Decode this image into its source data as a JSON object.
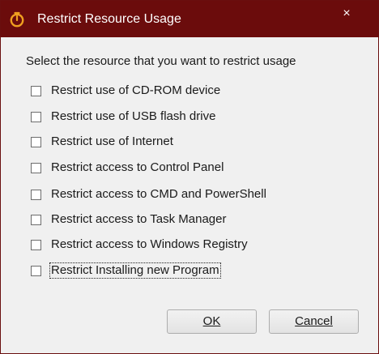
{
  "window": {
    "title": "Restrict Resource Usage",
    "close_glyph": "×",
    "icon": "timer-icon",
    "accent_color": "#6b0c0c"
  },
  "instruction": "Select the resource that you want to restrict usage",
  "options": [
    {
      "label": "Restrict use of CD-ROM device",
      "checked": false
    },
    {
      "label": "Restrict use of USB flash drive",
      "checked": false
    },
    {
      "label": "Restrict use of Internet",
      "checked": false
    },
    {
      "label": "Restrict access to Control Panel",
      "checked": false
    },
    {
      "label": "Restrict access to CMD and PowerShell",
      "checked": false
    },
    {
      "label": "Restrict access to Task Manager",
      "checked": false
    },
    {
      "label": "Restrict access to Windows Registry",
      "checked": false
    },
    {
      "label": "Restrict Installing new Program",
      "checked": false,
      "focused": true
    }
  ],
  "buttons": {
    "ok_label": "OK",
    "cancel_label": "Cancel"
  }
}
